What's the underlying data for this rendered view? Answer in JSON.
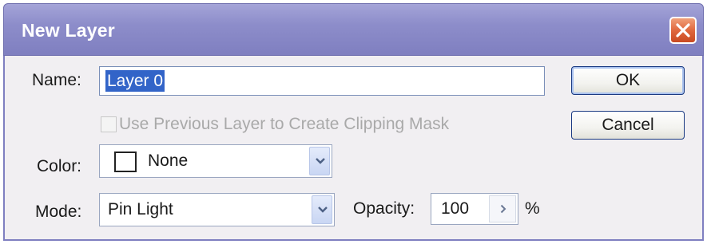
{
  "window": {
    "title": "New Layer",
    "close_icon": "close-icon",
    "accent_color": "#8d8dca"
  },
  "form": {
    "name_label": "Name:",
    "name_value": "Layer 0",
    "clipping_mask_label": "Use Previous Layer to Create Clipping Mask",
    "clipping_mask_checked": false,
    "clipping_mask_enabled": false,
    "color_label": "Color:",
    "color_value": "None",
    "mode_label": "Mode:",
    "mode_value": "Pin Light",
    "opacity_label": "Opacity:",
    "opacity_value": "100",
    "opacity_unit": "%"
  },
  "buttons": {
    "ok_label": "OK",
    "cancel_label": "Cancel"
  }
}
